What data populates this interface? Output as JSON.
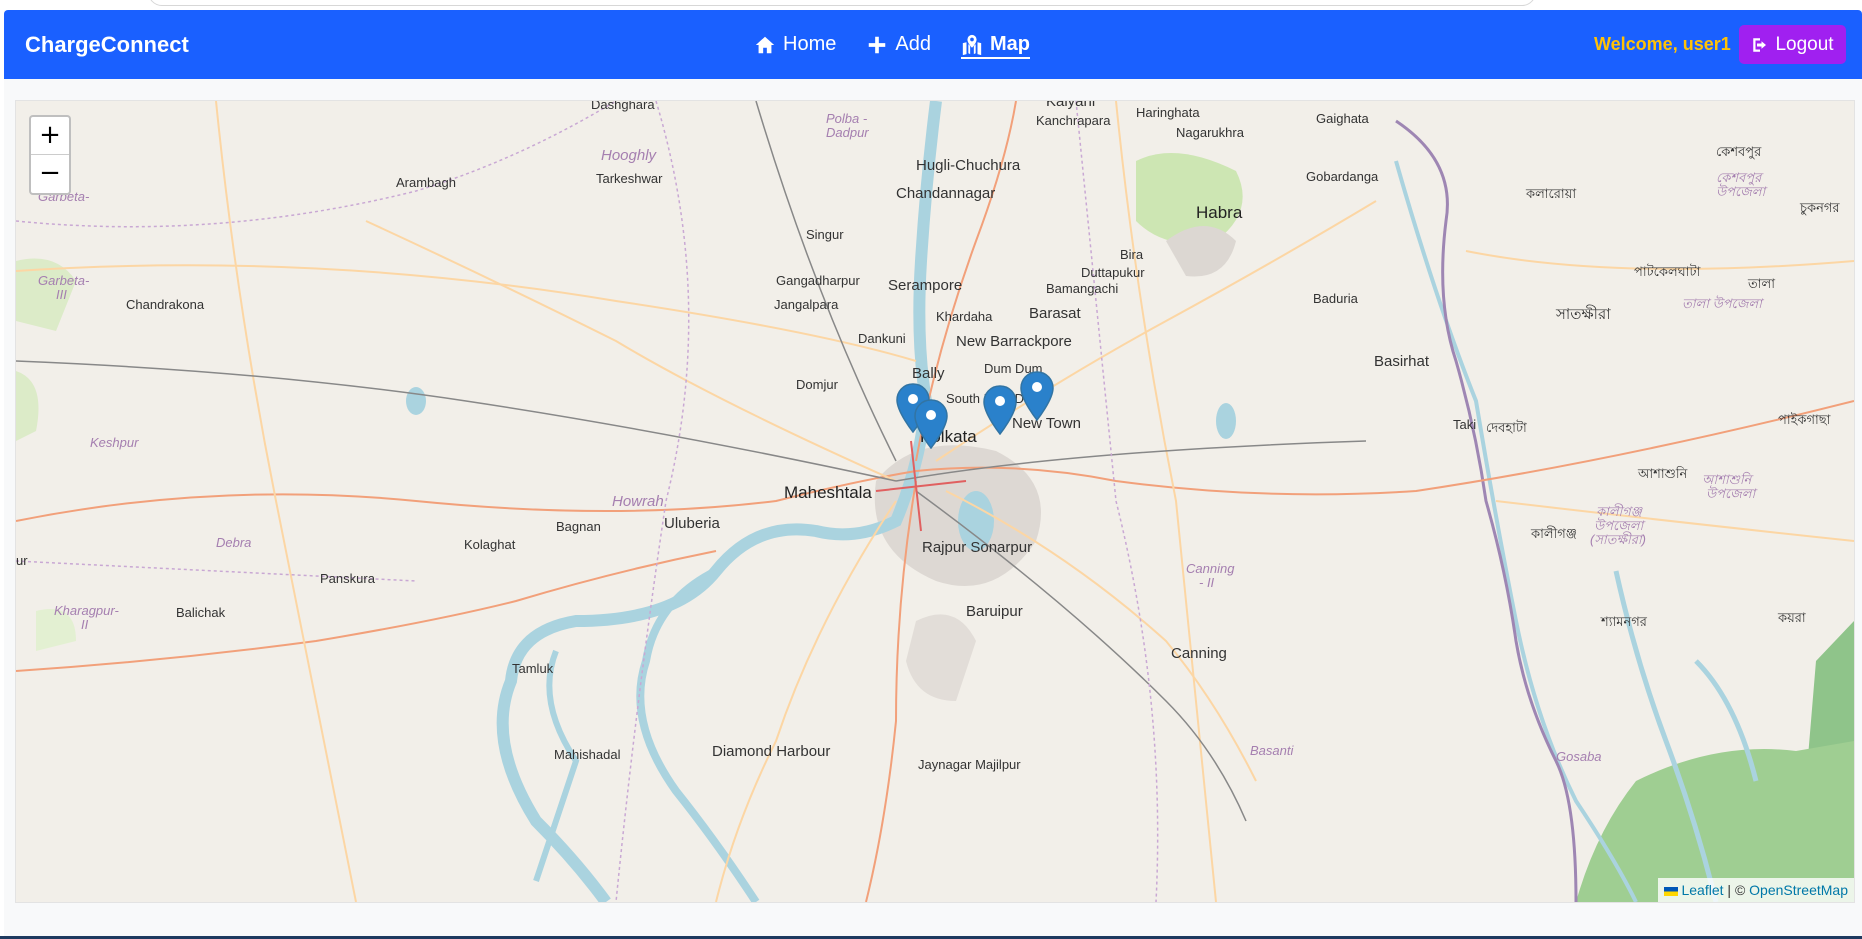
{
  "navbar": {
    "brand": "ChargeConnect",
    "links": [
      {
        "label": "Home",
        "icon": "home-icon",
        "active": false
      },
      {
        "label": "Add",
        "icon": "plus-icon",
        "active": false
      },
      {
        "label": "Map",
        "icon": "map-icon",
        "active": true
      }
    ],
    "welcome": "Welcome, user1",
    "logout_label": "Logout"
  },
  "map": {
    "zoom_in": "+",
    "zoom_out": "−",
    "attribution": {
      "leaflet": "Leaflet",
      "separator": " | © ",
      "osm": "OpenStreetMap"
    },
    "markers": [
      "station-marker",
      "station-marker",
      "station-marker",
      "station-marker"
    ],
    "place_labels": {
      "kolkata": "Kolkata",
      "new_town": "New Town",
      "maheshtala": "Maheshtala",
      "uluberia": "Uluberia",
      "rajpur": "Rajpur Sonarpur",
      "baruipur": "Baruipur",
      "canning": "Canning",
      "basirhat": "Basirhat",
      "barasat": "Barasat",
      "new_barrackpore": "New Barrackpore",
      "bally": "Bally",
      "serampore": "Serampore",
      "chandannagar": "Chandannagar",
      "hugli": "Hugli-Chuchura",
      "habra": "Habra",
      "diamond_harbour": "Diamond Harbour",
      "dum_dum": "Dum Dum",
      "south_dum_dum": "South Dum Dum",
      "howrah": "Howrah",
      "hooghly": "Hooghly",
      "arambagh": "Arambagh",
      "tarkeshwar": "Tarkeshwar",
      "singur": "Singur",
      "gangadharpur": "Gangadharpur",
      "jangalpara": "Jangalpara",
      "dankuni": "Dankuni",
      "domjur": "Domjur",
      "khardaha": "Khardaha",
      "bamangachi": "Bamangachi",
      "duttapukur": "Duttapukur",
      "bira": "Bira",
      "gobardanga": "Gobardanga",
      "gaighata": "Gaighata",
      "nagarukhra": "Nagarukhra",
      "haringhata": "Haringhata",
      "kanchrapara": "Kanchrapara",
      "kalyani": "Kalyani",
      "baduria": "Baduria",
      "taki": "Taki",
      "chandrakona": "Chandrakona",
      "keshpur": "Keshpur",
      "debra": "Debra",
      "kolaghat": "Kolaghat",
      "bagnan": "Bagnan",
      "panskura": "Panskura",
      "balichak": "Balichak",
      "kharagpur": "Kharagpur-",
      "kharagpur2": "II",
      "tamluk": "Tamluk",
      "mahishadal": "Mahishadal",
      "garbeta": "Garbeta-",
      "garbeta3": "Garbeta-",
      "garbeta3b": "III",
      "polba": "Polba -",
      "dadpur": "Dadpur",
      "dashghara": "Dashghara",
      "canning2": "Canning",
      "canning2b": "- II",
      "basanti": "Basanti",
      "gosaba": "Gosaba",
      "jaynagar": "Jaynagar Majilpur",
      "satkhira": "সাতক্ষীরা",
      "kalaroa": "কলারোয়া",
      "keshabpur": "কেশবপুর",
      "keshabpur_up": "কেশবপুর",
      "keshabpur_up2": "উপজেলা",
      "chuknagar": "চুকনগর",
      "patkelghata": "পাটকেলঘাটা",
      "tala": "তালা",
      "tala_up": "তালা উপজেলা",
      "debhata": "দেবহাটা",
      "paikgachha": "পাইকগাছা",
      "ashashuni": "আশাশুনি",
      "ashashuni_up": "আশাশুনি",
      "ashashuni_up2": "উপজেলা",
      "kaliganj": "কালীগঞ্জ",
      "kaliganj_up": "কালীগঞ্জ",
      "kaliganj_up2": "উপজেলা",
      "kaliganj_up3": "(সাতক্ষীরা)",
      "shyamnagar": "শ্যামনগর",
      "koyra": "কয়রা",
      "ur": "ur"
    }
  }
}
